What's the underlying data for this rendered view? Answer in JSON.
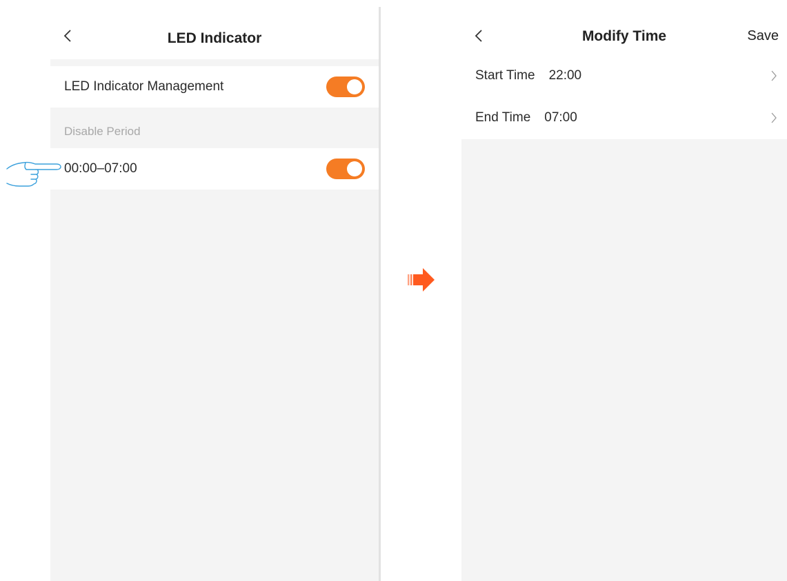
{
  "left_screen": {
    "title": "LED Indicator",
    "management_label": "LED Indicator Management",
    "management_enabled": true,
    "section_header": "Disable Period",
    "period_label": "00:00–07:00",
    "period_enabled": true
  },
  "right_screen": {
    "title": "Modify Time",
    "save_label": "Save",
    "start_label": "Start Time",
    "start_value": "22:00",
    "end_label": "End Time",
    "end_value": "07:00"
  },
  "colors": {
    "accent": "#f57c24",
    "page_background": "#f4f4f4",
    "hint_stroke": "#3aa0dc",
    "arrow": "#ff5a1f"
  },
  "icons": {
    "back": "chevron-left-icon",
    "row_arrow": "chevron-right-icon",
    "hint": "pointing-hand-icon",
    "transition": "right-arrow-icon"
  }
}
